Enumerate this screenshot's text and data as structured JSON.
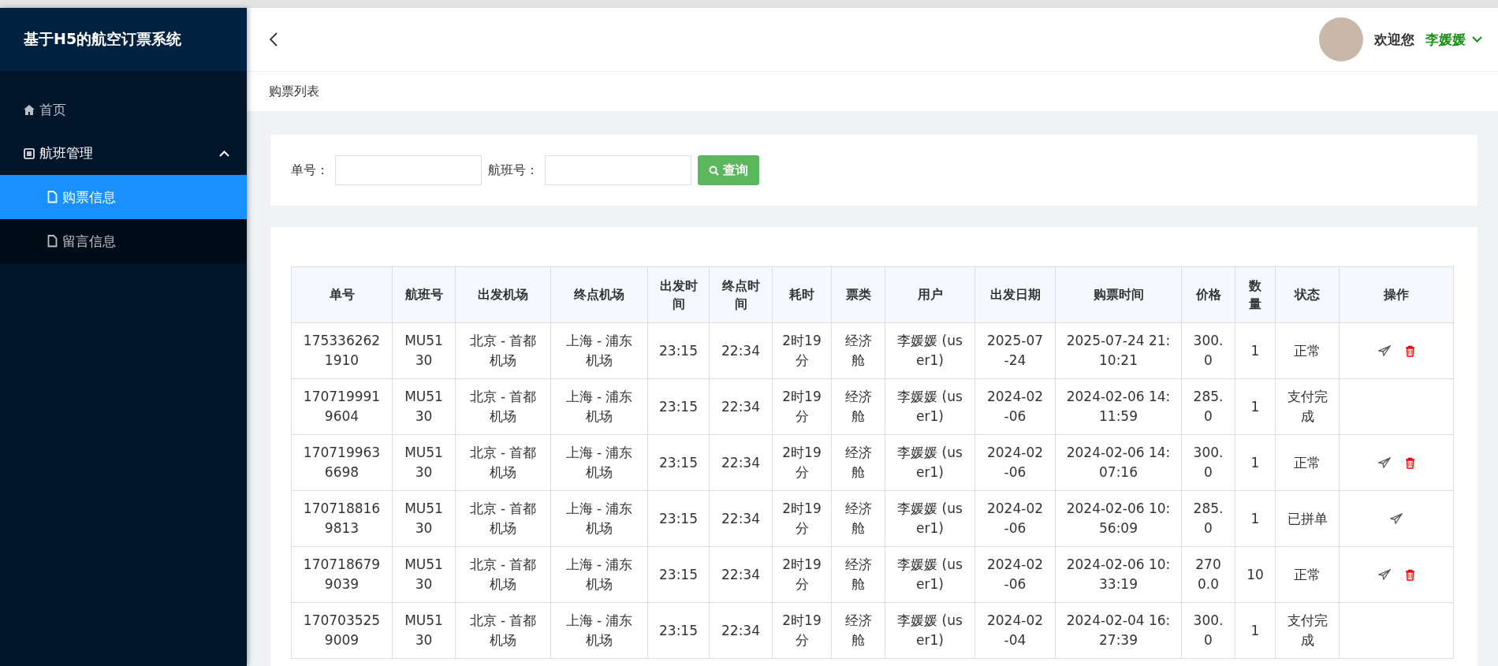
{
  "app_title": "基于H5的航空订票系统",
  "sidebar": {
    "items": [
      {
        "label": "首页",
        "kind": "link"
      },
      {
        "label": "航班管理",
        "kind": "group",
        "expanded": true,
        "children": [
          {
            "label": "购票信息",
            "selected": true
          },
          {
            "label": "留言信息",
            "selected": false
          }
        ]
      }
    ]
  },
  "header": {
    "greeting": "欢迎您",
    "user_name": "李媛媛"
  },
  "breadcrumb": "购票列表",
  "search": {
    "fields": [
      {
        "label": "单号："
      },
      {
        "label": "航班号："
      }
    ],
    "button": "查询"
  },
  "table": {
    "columns": [
      "单号",
      "航班号",
      "出发机场",
      "终点机场",
      "出发时间",
      "终点时间",
      "耗时",
      "票类",
      "用户",
      "出发日期",
      "购票时间",
      "价格",
      "数量",
      "状态",
      "操作"
    ],
    "rows": [
      {
        "cells": [
          "1753362621910",
          "MU5130",
          "北京 - 首都机场",
          "上海 - 浦东机场",
          "23:15",
          "22:34",
          "2时19分",
          "经济舱",
          "李媛媛 (user1)",
          "2025-07-24",
          "2025-07-24 21:10:21",
          "300.0",
          "1",
          "正常"
        ],
        "actions": [
          {
            "kind": "send"
          },
          {
            "kind": "delete"
          }
        ]
      },
      {
        "cells": [
          "1707199919604",
          "MU5130",
          "北京 - 首都机场",
          "上海 - 浦东机场",
          "23:15",
          "22:34",
          "2时19分",
          "经济舱",
          "李媛媛 (user1)",
          "2024-02-06",
          "2024-02-06 14:11:59",
          "285.0",
          "1",
          "支付完成"
        ],
        "actions": []
      },
      {
        "cells": [
          "1707199636698",
          "MU5130",
          "北京 - 首都机场",
          "上海 - 浦东机场",
          "23:15",
          "22:34",
          "2时19分",
          "经济舱",
          "李媛媛 (user1)",
          "2024-02-06",
          "2024-02-06 14:07:16",
          "300.0",
          "1",
          "正常"
        ],
        "actions": [
          {
            "kind": "send"
          },
          {
            "kind": "delete"
          }
        ]
      },
      {
        "cells": [
          "1707188169813",
          "MU5130",
          "北京 - 首都机场",
          "上海 - 浦东机场",
          "23:15",
          "22:34",
          "2时19分",
          "经济舱",
          "李媛媛 (user1)",
          "2024-02-06",
          "2024-02-06 10:56:09",
          "285.0",
          "1",
          "已拼单"
        ],
        "actions": [
          {
            "kind": "send"
          }
        ]
      },
      {
        "cells": [
          "1707186799039",
          "MU5130",
          "北京 - 首都机场",
          "上海 - 浦东机场",
          "23:15",
          "22:34",
          "2时19分",
          "经济舱",
          "李媛媛 (user1)",
          "2024-02-06",
          "2024-02-06 10:33:19",
          "2700.0",
          "10",
          "正常"
        ],
        "actions": [
          {
            "kind": "send"
          },
          {
            "kind": "delete"
          }
        ]
      },
      {
        "cells": [
          "1707035259009",
          "MU5130",
          "北京 - 首都机场",
          "上海 - 浦东机场",
          "23:15",
          "22:34",
          "2时19分",
          "经济舱",
          "李媛媛 (user1)",
          "2024-02-04",
          "2024-02-04 16:27:39",
          "300.0",
          "1",
          "支付完成"
        ],
        "actions": []
      }
    ]
  }
}
